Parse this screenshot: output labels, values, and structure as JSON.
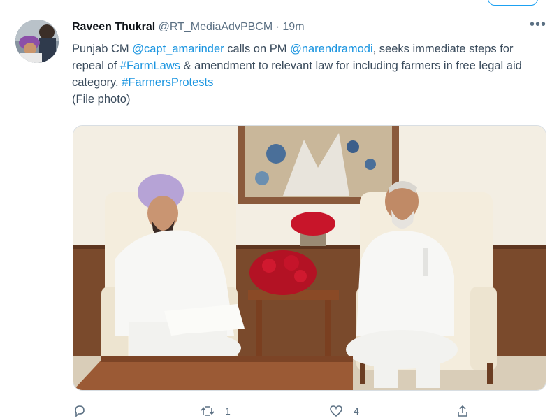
{
  "tweet": {
    "author_name": "Raveen Thukral",
    "handle": "@RT_MediaAdvPBCM",
    "separator": "·",
    "time": "19m",
    "more_label": "•••",
    "text": {
      "p1": "Punjab CM ",
      "mention1": "@capt_amarinder",
      "p2": " calls on PM ",
      "mention2": "@narendramodi",
      "p3": ", seeks immediate steps for repeal of ",
      "hashtag1": "#FarmLaws",
      "p4": " & amendment to relevant law for including farmers in free legal aid category. ",
      "hashtag2": "#FarmersProtests",
      "line2": "(File photo)"
    },
    "actions": {
      "reply_count": "",
      "retweet_count": "1",
      "like_count": "4"
    }
  },
  "colors": {
    "link": "#1b95e0",
    "secondary_text": "#5b7083",
    "wall": "#efe8da",
    "wood": "#7a4326",
    "flowers": "#c8152a"
  },
  "icons": [
    "reply-icon",
    "retweet-icon",
    "like-icon",
    "share-icon",
    "more-icon"
  ]
}
